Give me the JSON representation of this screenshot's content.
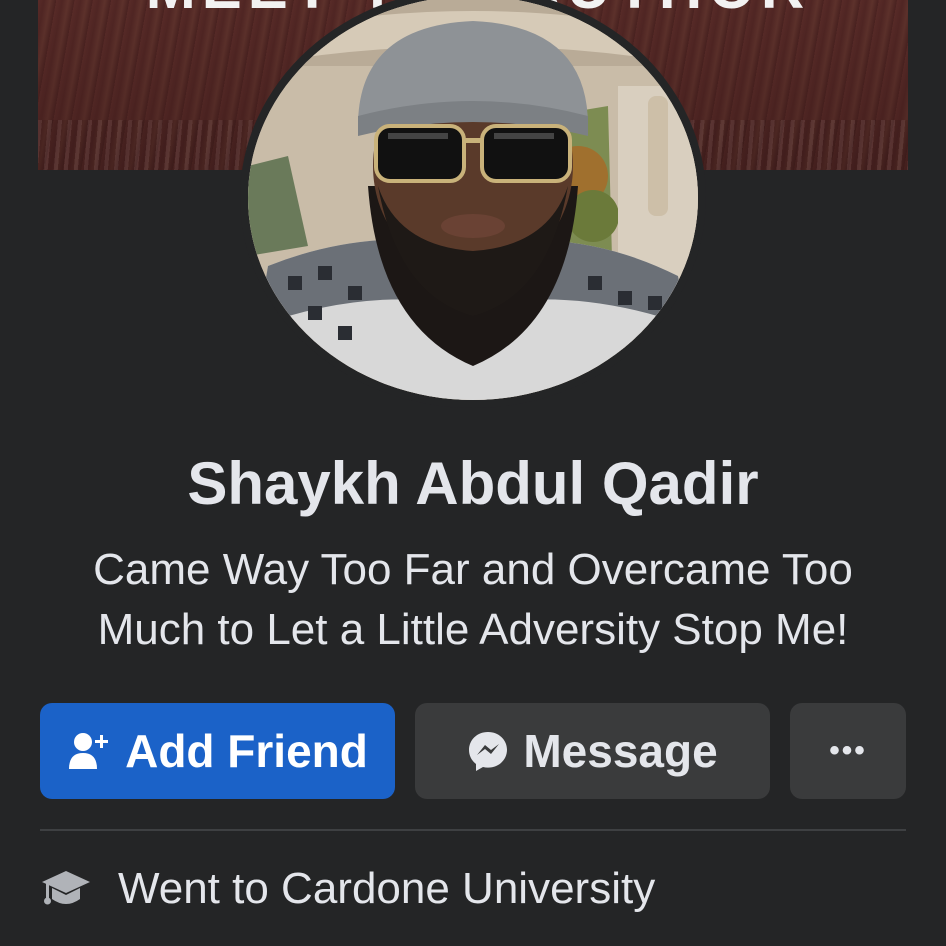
{
  "cover": {
    "banner_text": "MEET THE AUTHOR"
  },
  "profile": {
    "name": "Shaykh Abdul Qadir",
    "bio_line1": "Came Way Too Far and Overcame Too",
    "bio_line2": "Much to Let a Little Adversity Stop Me!"
  },
  "actions": {
    "add_friend_label": "Add Friend",
    "add_friend_icon": "person-add-icon",
    "message_label": "Message",
    "message_icon": "messenger-icon",
    "more_label": "•••",
    "more_icon": "more-options-icon"
  },
  "intro": {
    "education_text": "Went to Cardone University",
    "education_icon": "graduation-cap-icon"
  },
  "colors": {
    "background": "#242526",
    "primary_button": "#1b62c8",
    "secondary_button": "#3a3b3c",
    "text": "#e4e6eb"
  }
}
